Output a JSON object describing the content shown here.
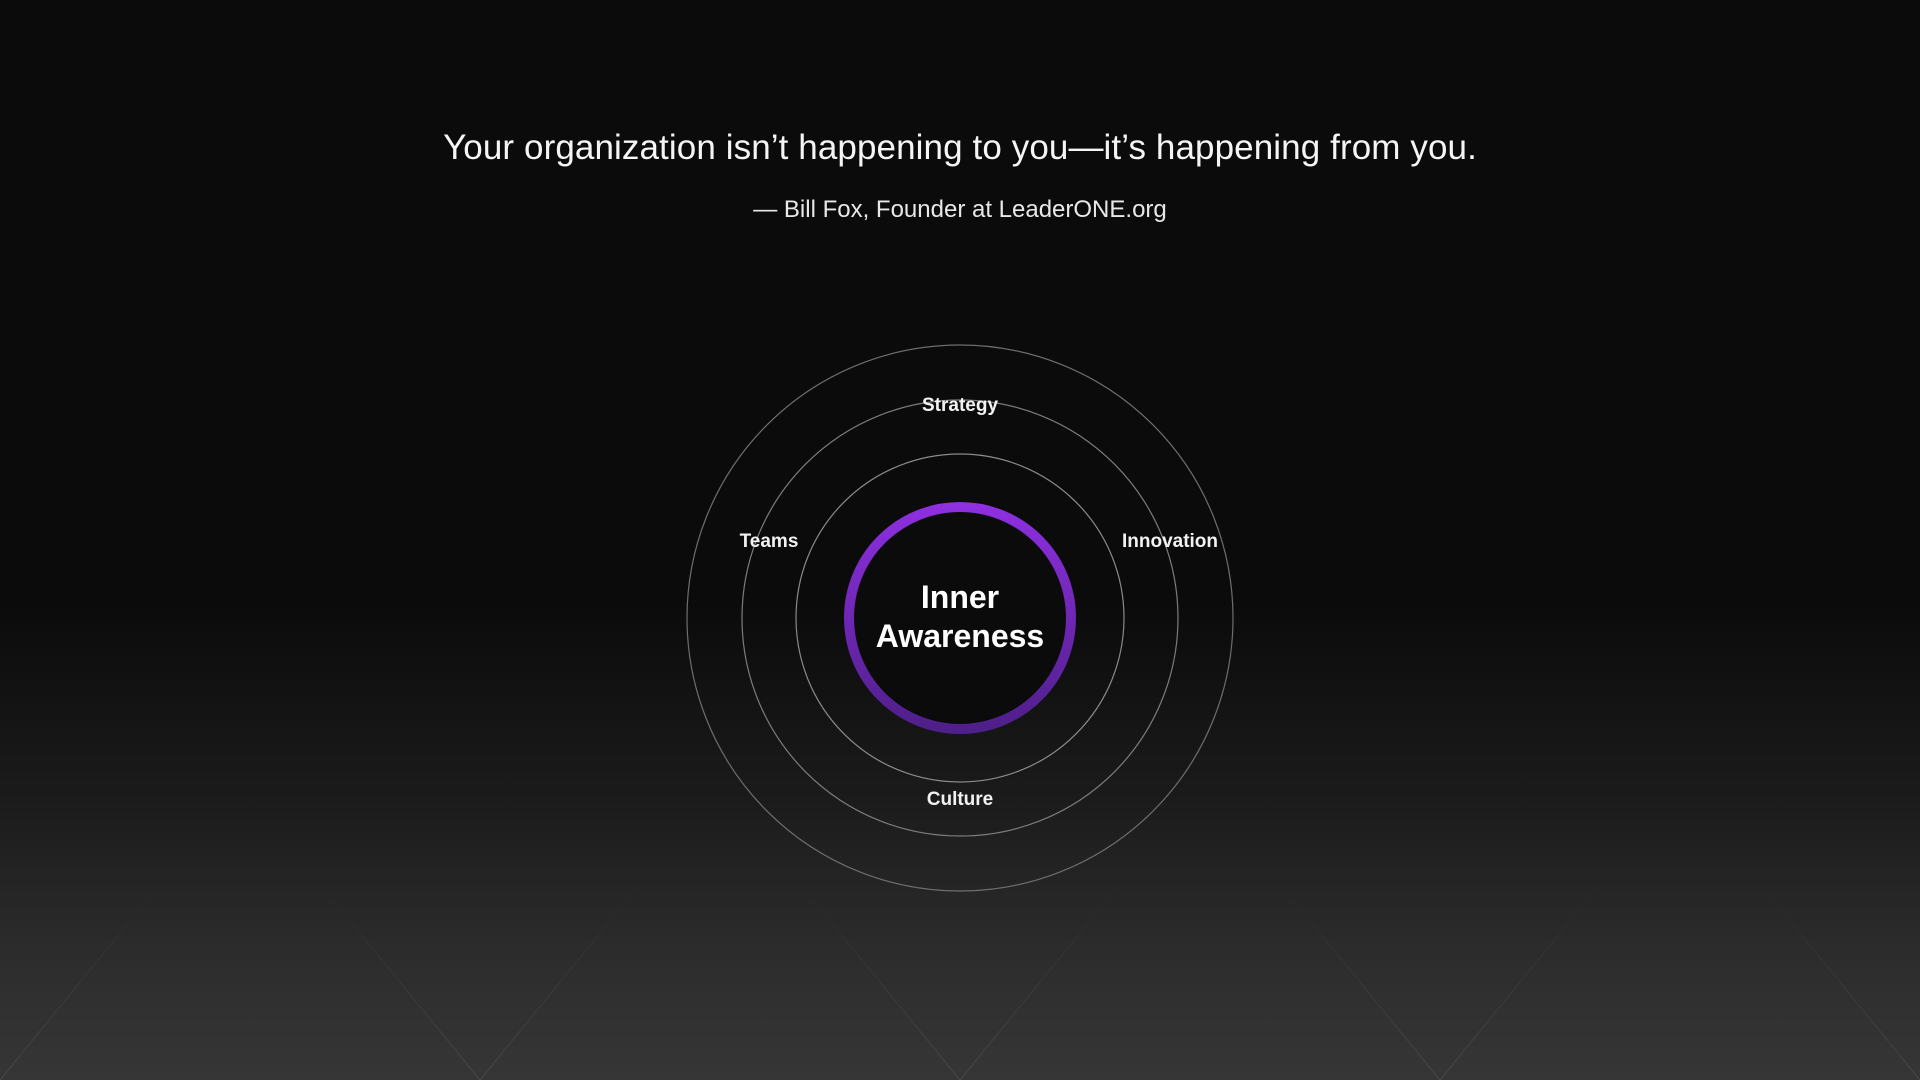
{
  "quote": {
    "text": "Your organization isn’t happening to you—it’s happening from you.",
    "attribution": "— Bill Fox, Founder at LeaderONE.org"
  },
  "diagram": {
    "core": {
      "line1": "Inner",
      "line2": "Awareness",
      "ring_gradient": [
        "#8e2fe0",
        "#4f1f8a"
      ]
    },
    "labels": {
      "top": "Strategy",
      "left": "Teams",
      "right": "Innovation",
      "bottom": "Culture"
    },
    "ring_color": "#8a8a8a"
  },
  "colors": {
    "background_top": "#0b0b0c",
    "background_bottom": "#363636",
    "accent": "#8e2fe0"
  }
}
